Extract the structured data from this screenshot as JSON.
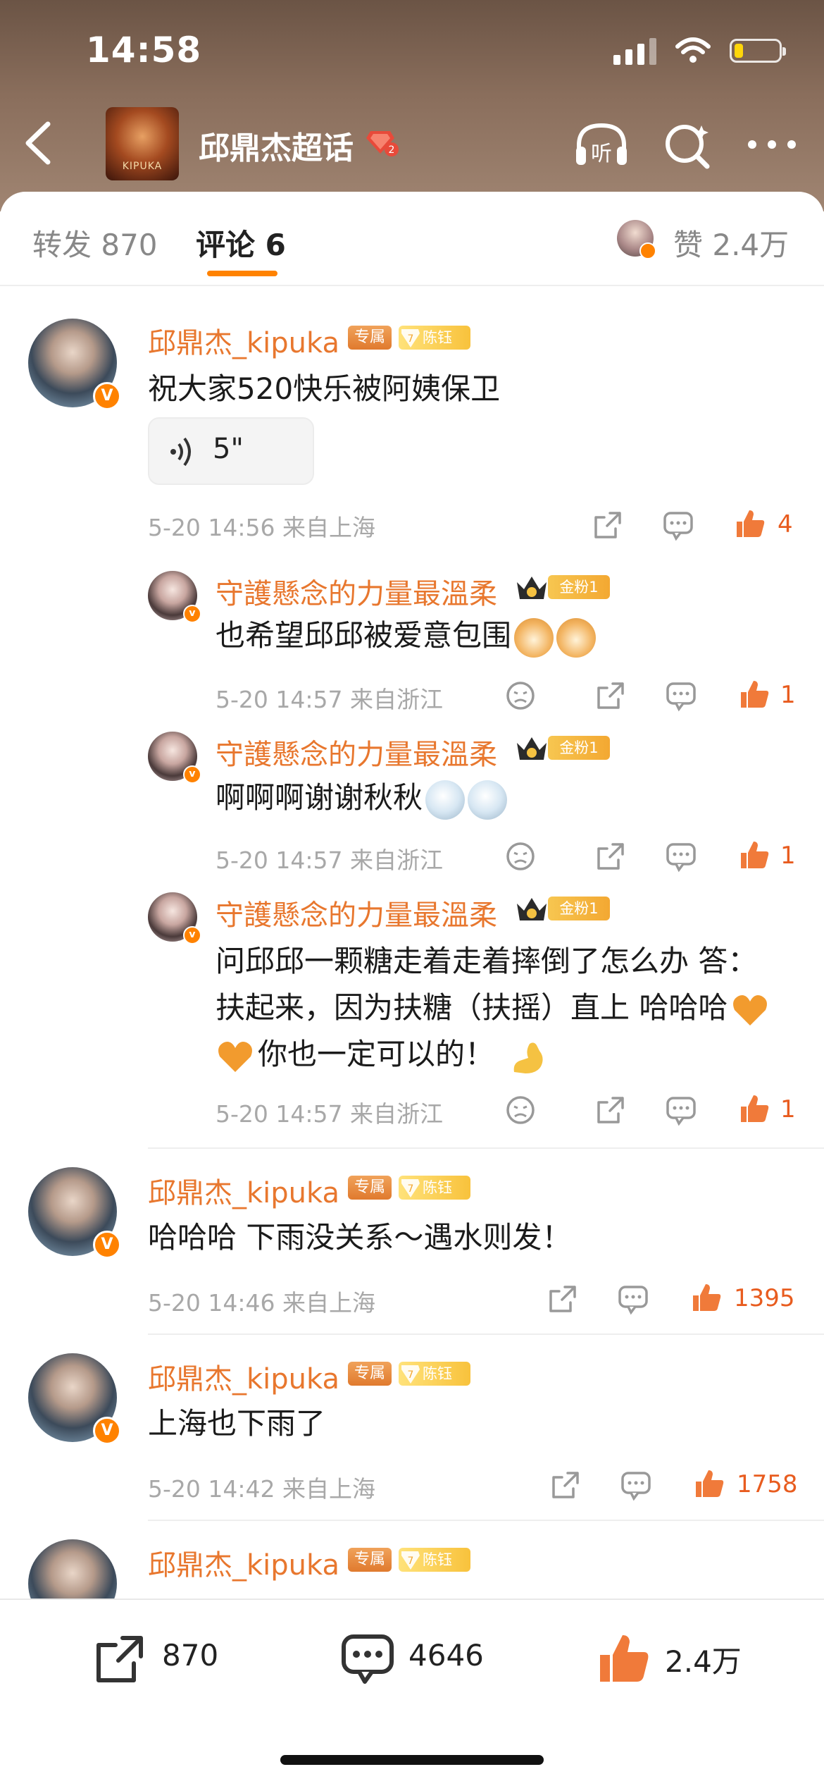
{
  "status": {
    "time": "14:58",
    "battery_level": 0.2
  },
  "header": {
    "topic_title": "邱鼎杰超话",
    "thumb_text": "KIPUKA",
    "listen_label": "听"
  },
  "tabs": {
    "repost": "转发 870",
    "comment": "评论 6",
    "like": "赞 2.4万"
  },
  "comments": [
    {
      "user": "邱鼎杰_kipuka",
      "tag": "专属",
      "fan_level": "7",
      "fan_label": "陈钰",
      "text": "祝大家520快乐被阿姨保卫",
      "voice_duration": "5\"",
      "time": "5-20 14:56",
      "location": "来自上海",
      "likes": "4",
      "replies": [
        {
          "user": "守護懸念的力量最溫柔",
          "badge": "金粉1",
          "text": "也希望邱邱被爱意包围",
          "emojis": [
            "dog-emoji",
            "dog-emoji"
          ],
          "time": "5-20 14:57",
          "location": "来自浙江",
          "likes": "1"
        },
        {
          "user": "守護懸念的力量最溫柔",
          "badge": "金粉1",
          "text": "啊啊啊谢谢秋秋",
          "emojis": [
            "bye-face-emoji",
            "bye-face-emoji"
          ],
          "time": "5-20 14:57",
          "location": "来自浙江",
          "likes": "1"
        },
        {
          "user": "守護懸念的力量最溫柔",
          "badge": "金粉1",
          "text_line1": "问邱邱一颗糖走着走着摔倒了怎么办 答：",
          "text_line2": "扶起来，因为扶糖（扶摇）直上 哈哈哈",
          "text_line3": "你也一定可以的！",
          "emojis": [
            "orange-heart-emoji",
            "orange-heart-emoji",
            "flexed-biceps-emoji"
          ],
          "time": "5-20 14:57",
          "location": "来自浙江",
          "likes": "1"
        }
      ]
    },
    {
      "user": "邱鼎杰_kipuka",
      "tag": "专属",
      "fan_level": "7",
      "fan_label": "陈钰",
      "text": "哈哈哈 下雨没关系～遇水则发！",
      "time": "5-20 14:46",
      "location": "来自上海",
      "likes": "1395"
    },
    {
      "user": "邱鼎杰_kipuka",
      "tag": "专属",
      "fan_level": "7",
      "fan_label": "陈钰",
      "text": "上海也下雨了",
      "time": "5-20 14:42",
      "location": "来自上海",
      "likes": "1758"
    },
    {
      "user": "邱鼎杰_kipuka",
      "tag": "专属",
      "fan_level": "7",
      "fan_label": "陈钰"
    }
  ],
  "bottom_bar": {
    "reposts": "870",
    "comments": "4646",
    "likes": "2.4万"
  },
  "colors": {
    "accent": "#ff8200",
    "username": "#e8772e",
    "like": "#e85c1f"
  }
}
